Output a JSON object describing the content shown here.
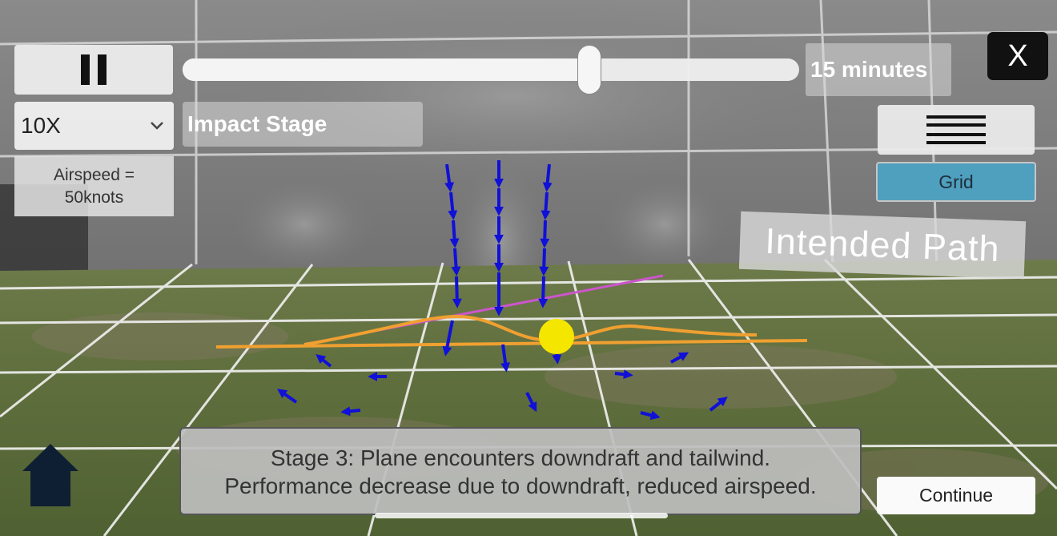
{
  "controls": {
    "pause_icon": "pause-icon",
    "timeline_progress": 0.66,
    "duration": "15 minutes",
    "close_label": "X",
    "speed": "10X",
    "stage_name": "Impact Stage",
    "airspeed": "Airspeed = 50knots",
    "menu_icon": "hamburger-menu-icon",
    "grid_label": "Grid"
  },
  "scene": {
    "path_label": "Intended Path",
    "colors": {
      "intended_path": "#cc55cc",
      "flight_path": "#f0a030",
      "wind_arrows": "#1010d8",
      "aircraft": "#f5e600"
    }
  },
  "footer": {
    "home_icon": "home-icon",
    "description_line1": "Stage 3: Plane encounters downdraft and tailwind.",
    "description_line2": "Performance decrease due to downdraft, reduced airspeed.",
    "continue_label": "Continue"
  }
}
